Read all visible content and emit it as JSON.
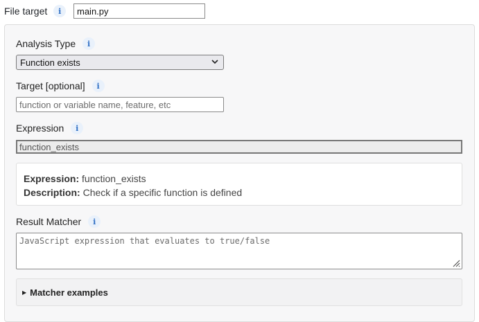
{
  "file_target": {
    "label": "File target",
    "value": "main.py"
  },
  "analysis_type": {
    "label": "Analysis Type",
    "selected": "Function exists"
  },
  "target": {
    "label": "Target [optional]",
    "placeholder": "function or variable name, feature, etc"
  },
  "expression": {
    "label": "Expression",
    "value": "function_exists"
  },
  "info": {
    "expression_key": "Expression:",
    "expression_value": "function_exists",
    "description_key": "Description:",
    "description_value": "Check if a specific function is defined"
  },
  "result_matcher": {
    "label": "Result Matcher",
    "placeholder": "JavaScript expression that evaluates to true/false"
  },
  "matcher_examples": {
    "label": "Matcher examples"
  },
  "icons": {
    "info": "i",
    "chevron": "⌄",
    "disclosure": "▶"
  },
  "colors": {
    "info_icon_bg": "#e9f1fb",
    "info_icon_fg": "#2f6fc4",
    "panel_bg": "#f7f7f8"
  }
}
